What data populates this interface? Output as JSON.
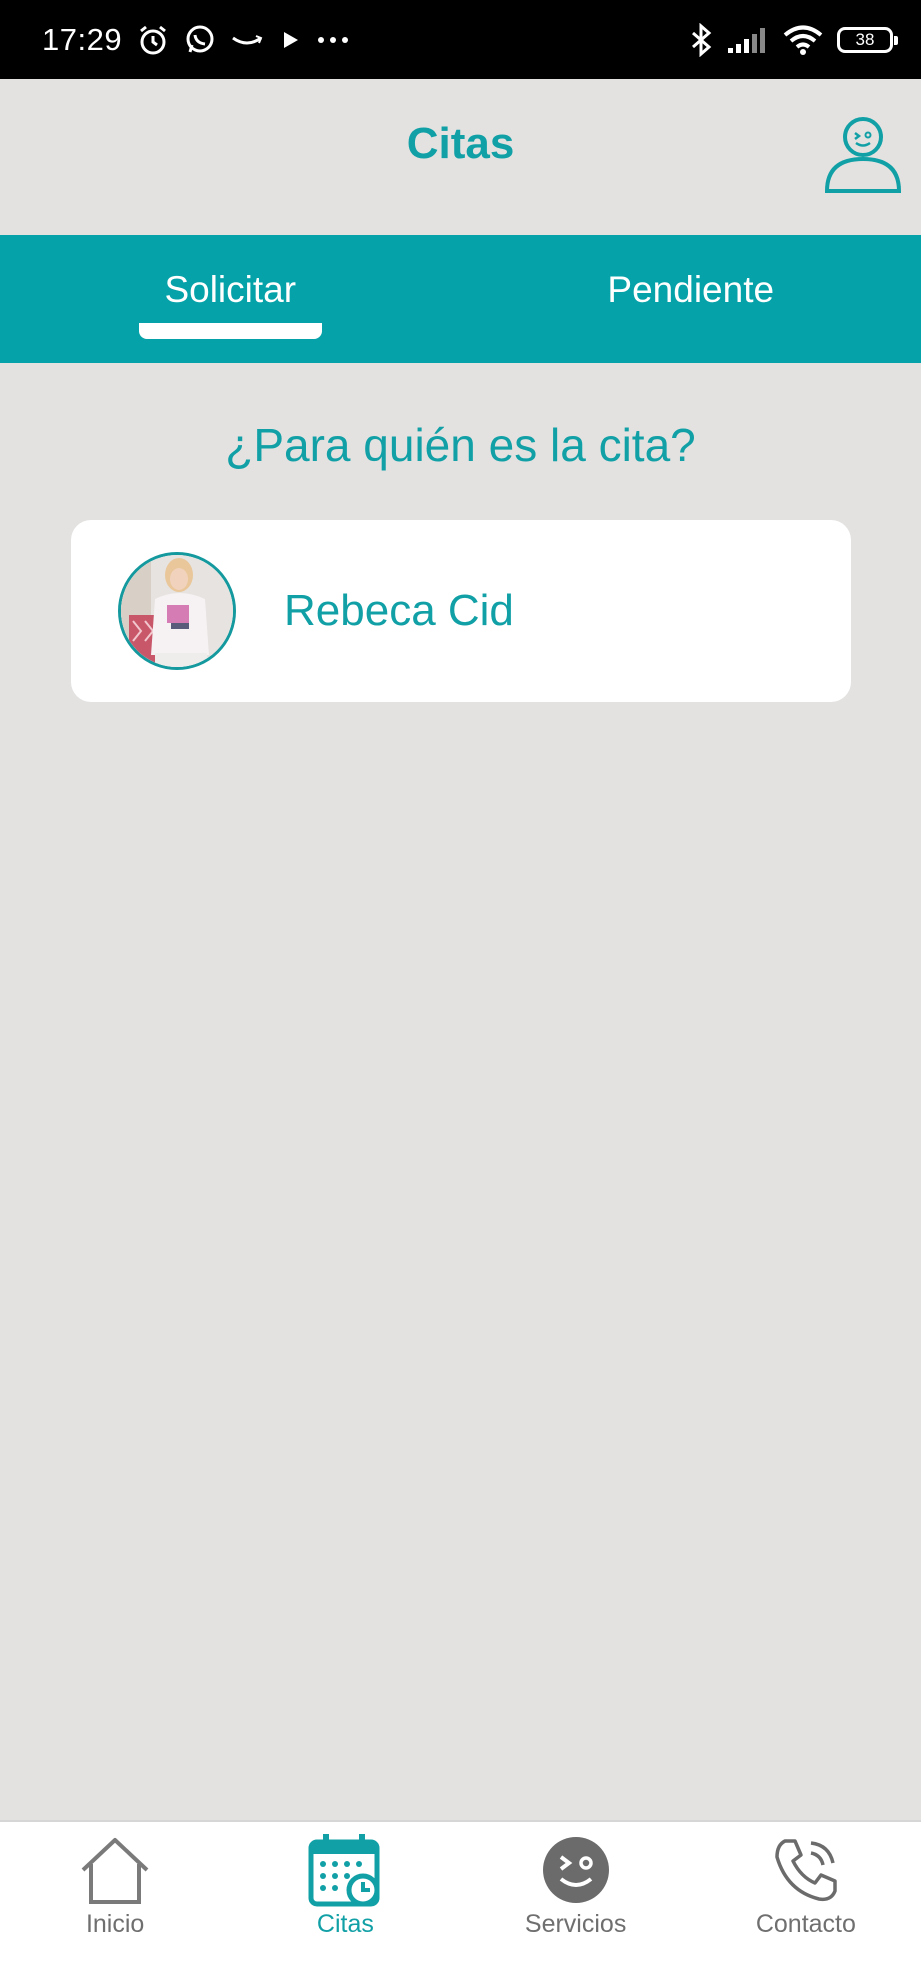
{
  "status_bar": {
    "time": "17:29",
    "battery": "38",
    "icons": [
      "alarm-icon",
      "whatsapp-icon",
      "amazon-icon",
      "play-icon",
      "more-icon",
      "bluetooth-icon",
      "signal-icon",
      "wifi-icon",
      "battery-icon"
    ]
  },
  "header": {
    "title": "Citas",
    "profile_icon": "user-profile-icon"
  },
  "tabs": [
    {
      "label": "Solicitar",
      "active": true
    },
    {
      "label": "Pendiente",
      "active": false
    }
  ],
  "main": {
    "question": "¿Para quién es la cita?",
    "people": [
      {
        "name": "Rebeca Cid"
      }
    ]
  },
  "bottom_nav": [
    {
      "label": "Inicio",
      "icon": "home-icon",
      "active": false
    },
    {
      "label": "Citas",
      "icon": "calendar-clock-icon",
      "active": true
    },
    {
      "label": "Servicios",
      "icon": "services-face-icon",
      "active": false
    },
    {
      "label": "Contacto",
      "icon": "phone-icon",
      "active": false
    }
  ],
  "colors": {
    "accent": "#05a3a9",
    "text_accent": "#11a0a6",
    "background": "#e3e2e1",
    "nav_inactive": "#6f6f6f"
  }
}
